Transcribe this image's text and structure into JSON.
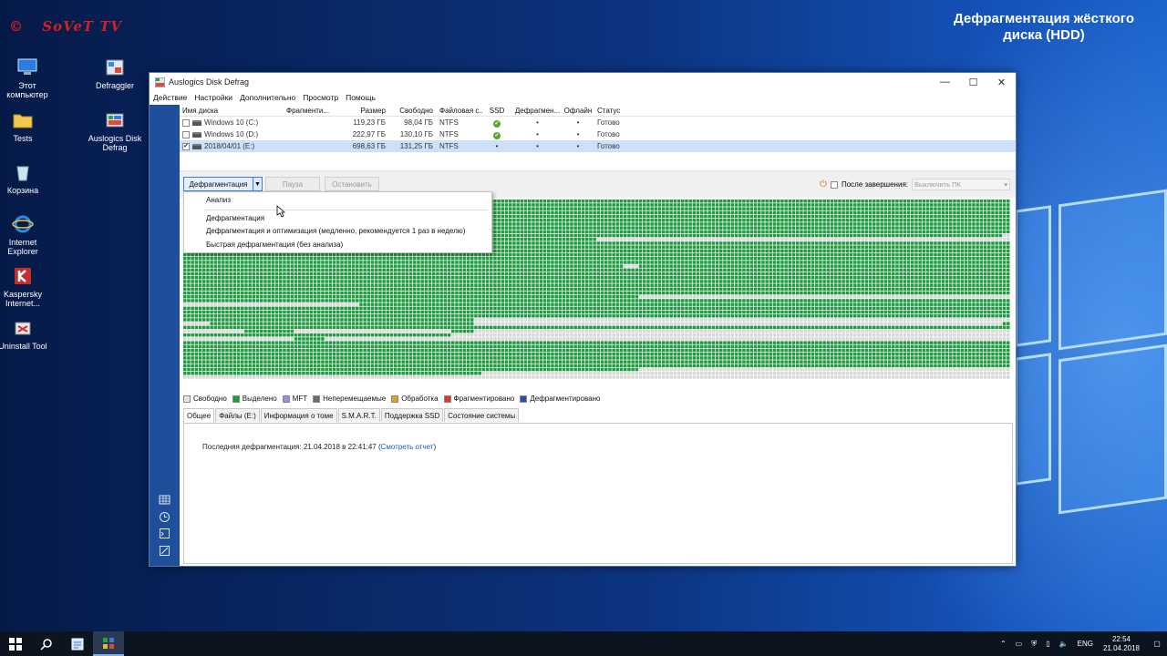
{
  "overlay": {
    "brand": "SoVeT TV",
    "title": "Дефрагментация жёсткого диска (HDD)"
  },
  "desktop_icons": [
    {
      "label": "Этот компьютер",
      "icon": "this-pc-icon"
    },
    {
      "label": "Defraggler",
      "icon": "defraggler-icon"
    },
    {
      "label": "Tests",
      "icon": "folder-icon"
    },
    {
      "label": "Auslogics Disk Defrag",
      "icon": "auslogics-icon"
    },
    {
      "label": "Корзина",
      "icon": "recycle-bin-icon"
    },
    {
      "label": "Internet Explorer",
      "icon": "internet-explorer-icon"
    },
    {
      "label": "Kaspersky Internet...",
      "icon": "kaspersky-icon"
    },
    {
      "label": "Uninstall Tool",
      "icon": "uninstall-tool-icon"
    }
  ],
  "window": {
    "title": "Auslogics Disk Defrag",
    "controls": {
      "minimize": "—",
      "maximize": "☐",
      "close": "✕"
    }
  },
  "menu": [
    "Действие",
    "Настройки",
    "Дополнительно",
    "Просмотр",
    "Помощь"
  ],
  "drive_table": {
    "columns": [
      "Имя диска",
      "Фрагменти...",
      "Размер",
      "Свободно",
      "Файловая с...",
      "SSD",
      "Дефрагмен...",
      "Офлайн",
      "Статус"
    ],
    "rows": [
      {
        "checked": false,
        "name": "Windows 10 (C:)",
        "frag": "",
        "size": "119,23 ГБ",
        "free": "98,04 ГБ",
        "fs": "NTFS",
        "ssd": "✔",
        "defrag": "•",
        "offline": "•",
        "status": "Готово",
        "selected": false
      },
      {
        "checked": false,
        "name": "Windows 10 (D:)",
        "frag": "",
        "size": "222,97 ГБ",
        "free": "130,10 ГБ",
        "fs": "NTFS",
        "ssd": "✔",
        "defrag": "•",
        "offline": "•",
        "status": "Готово",
        "selected": false
      },
      {
        "checked": true,
        "name": "2018/04/01 (E:)",
        "frag": "",
        "size": "698,63 ГБ",
        "free": "131,25 ГБ",
        "fs": "NTFS",
        "ssd": "•",
        "defrag": "•",
        "offline": "•",
        "status": "Готово",
        "selected": true
      }
    ]
  },
  "toolbar": {
    "defrag_button": "Дефрагментация",
    "pause_button": "Пауза",
    "stop_button": "Остановить",
    "after_label": "После завершения:",
    "after_select": "Выключить ПК"
  },
  "dropdown": {
    "items": [
      "Анализ",
      "Дефрагментация",
      "Дефрагментация и оптимизация (медленно, рекомендуется 1 раз в неделю)",
      "Быстрая дефрагментация (без анализа)"
    ]
  },
  "cluster_map": {
    "colors": {
      "free": "#d9d9d9",
      "allocated": "#1f9a40",
      "grid": "#ffffff"
    }
  },
  "legend": [
    {
      "label": "Свободно",
      "color": "#e6e6e6"
    },
    {
      "label": "Выделено",
      "color": "#1f9a40"
    },
    {
      "label": "MFT",
      "color": "#9a8ee0"
    },
    {
      "label": "Неперемещаемые",
      "color": "#6b6b6b"
    },
    {
      "label": "Обработка",
      "color": "#e6a02a"
    },
    {
      "label": "Фрагментировано",
      "color": "#d83a2a"
    },
    {
      "label": "Дефрагментировано",
      "color": "#2a4fa8"
    }
  ],
  "tabs": [
    "Общее",
    "Файлы (E:)",
    "Информация о томе",
    "S.M.A.R.T.",
    "Поддержка SSD",
    "Состояние системы"
  ],
  "general": {
    "last_defrag_text": "Последняя дефрагментация: 21.04.2018 в 22:41:47 (",
    "report_link": "Смотреть отчет",
    "last_defrag_close": ")"
  },
  "taskbar": {
    "lang": "ENG",
    "time": "22:54",
    "date": "21.04.2018"
  }
}
